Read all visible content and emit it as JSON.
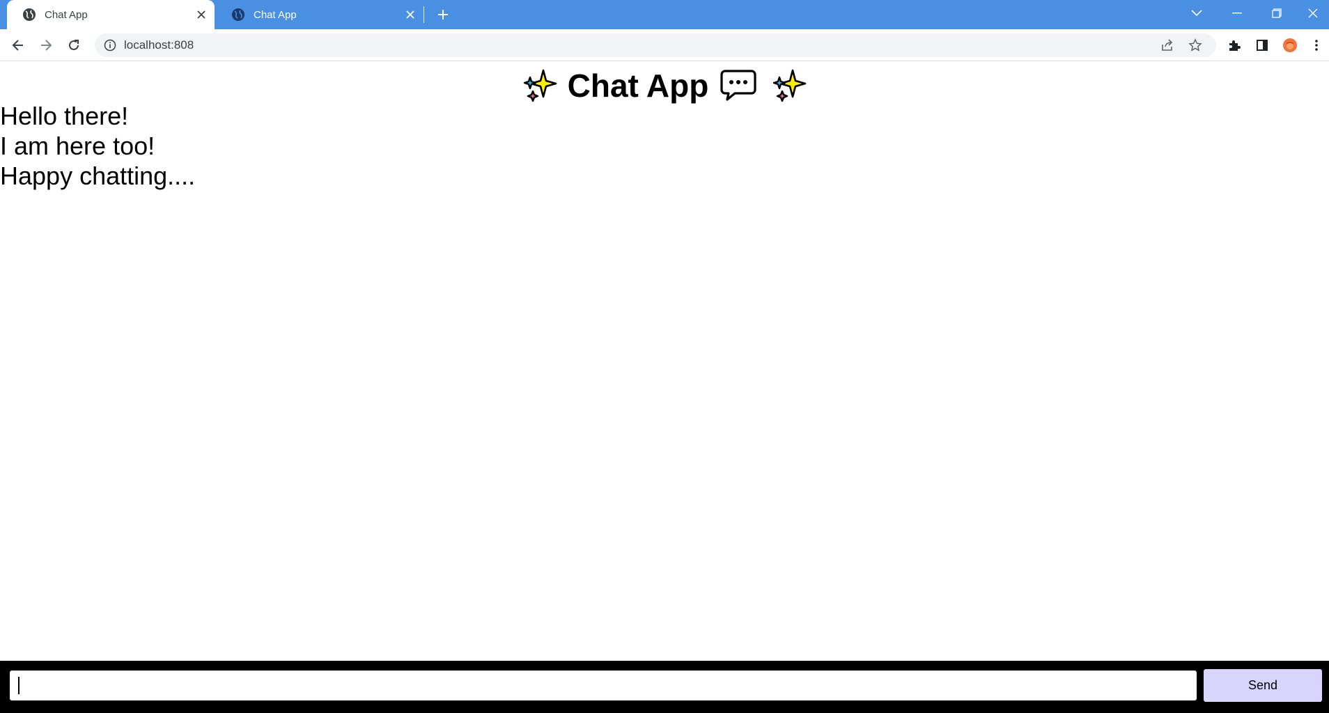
{
  "browser": {
    "tabs": [
      {
        "title": "Chat App",
        "active": true
      },
      {
        "title": "Chat App",
        "active": false
      }
    ],
    "address": "localhost:808",
    "accent_color": "#4a90e2"
  },
  "page": {
    "heading": "Chat App",
    "heading_emojis": [
      "sparkles",
      "speech-bubble",
      "sparkles"
    ],
    "messages": [
      "Hello there!",
      "I am here too!",
      "Happy chatting...."
    ],
    "input": {
      "value": ""
    },
    "send_label": "Send",
    "send_color": "#d8d4fc"
  }
}
